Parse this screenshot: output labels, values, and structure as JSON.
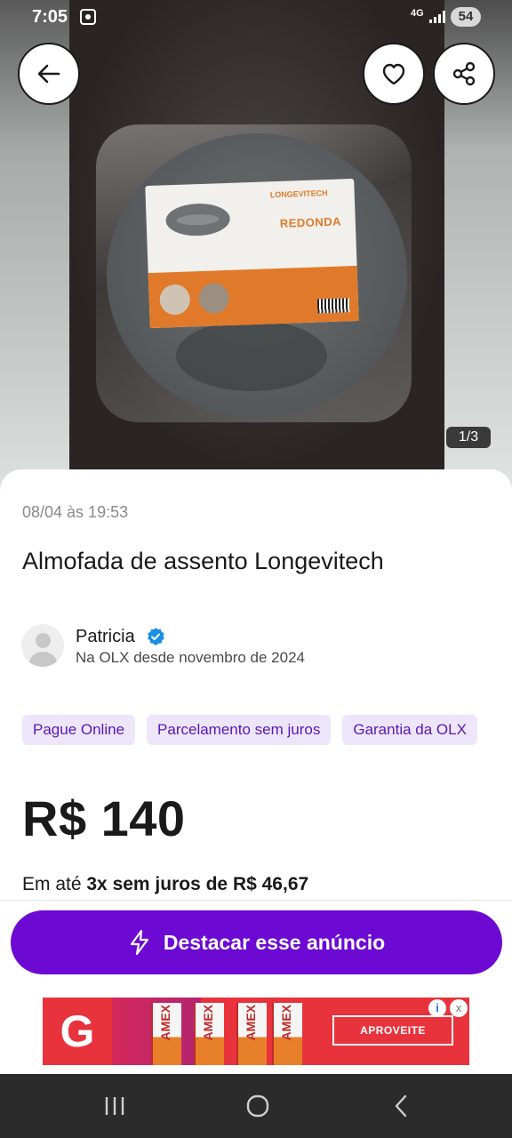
{
  "status_bar": {
    "time": "7:05",
    "network": "4G",
    "battery": "54"
  },
  "photo": {
    "counter": "1/3",
    "label_brand": "LONGEVITECH",
    "label_title": "REDONDA"
  },
  "listing": {
    "date": "08/04 às 19:53",
    "title": "Almofada de assento Longevitech",
    "seller": {
      "name": "Patricia",
      "since": "Na OLX desde novembro de 2024"
    },
    "badges": [
      "Pague Online",
      "Parcelamento sem juros",
      "Garantia da OLX"
    ],
    "price": "R$ 140",
    "installments_prefix": "Em até ",
    "installments_bold": "3x sem juros de R$ 46,67"
  },
  "actions": {
    "highlight_label": "Destacar esse anúncio"
  },
  "ad": {
    "logo_letter": "G",
    "product_label": "AMEX",
    "cta_label": "APROVEITE",
    "info_symbol": "i",
    "close_symbol": "x"
  },
  "colors": {
    "accent": "#6c0ad3",
    "badge_bg": "#ede6fb",
    "badge_text": "#5b17b3",
    "ad_red": "#e8333d"
  },
  "icons": {
    "back": "arrow-left-icon",
    "favorite": "heart-icon",
    "share": "share-icon",
    "verified": "verified-check-icon",
    "highlight": "lightning-icon",
    "nav_recents": "recents-icon",
    "nav_home": "home-icon",
    "nav_back": "back-chevron-icon"
  }
}
